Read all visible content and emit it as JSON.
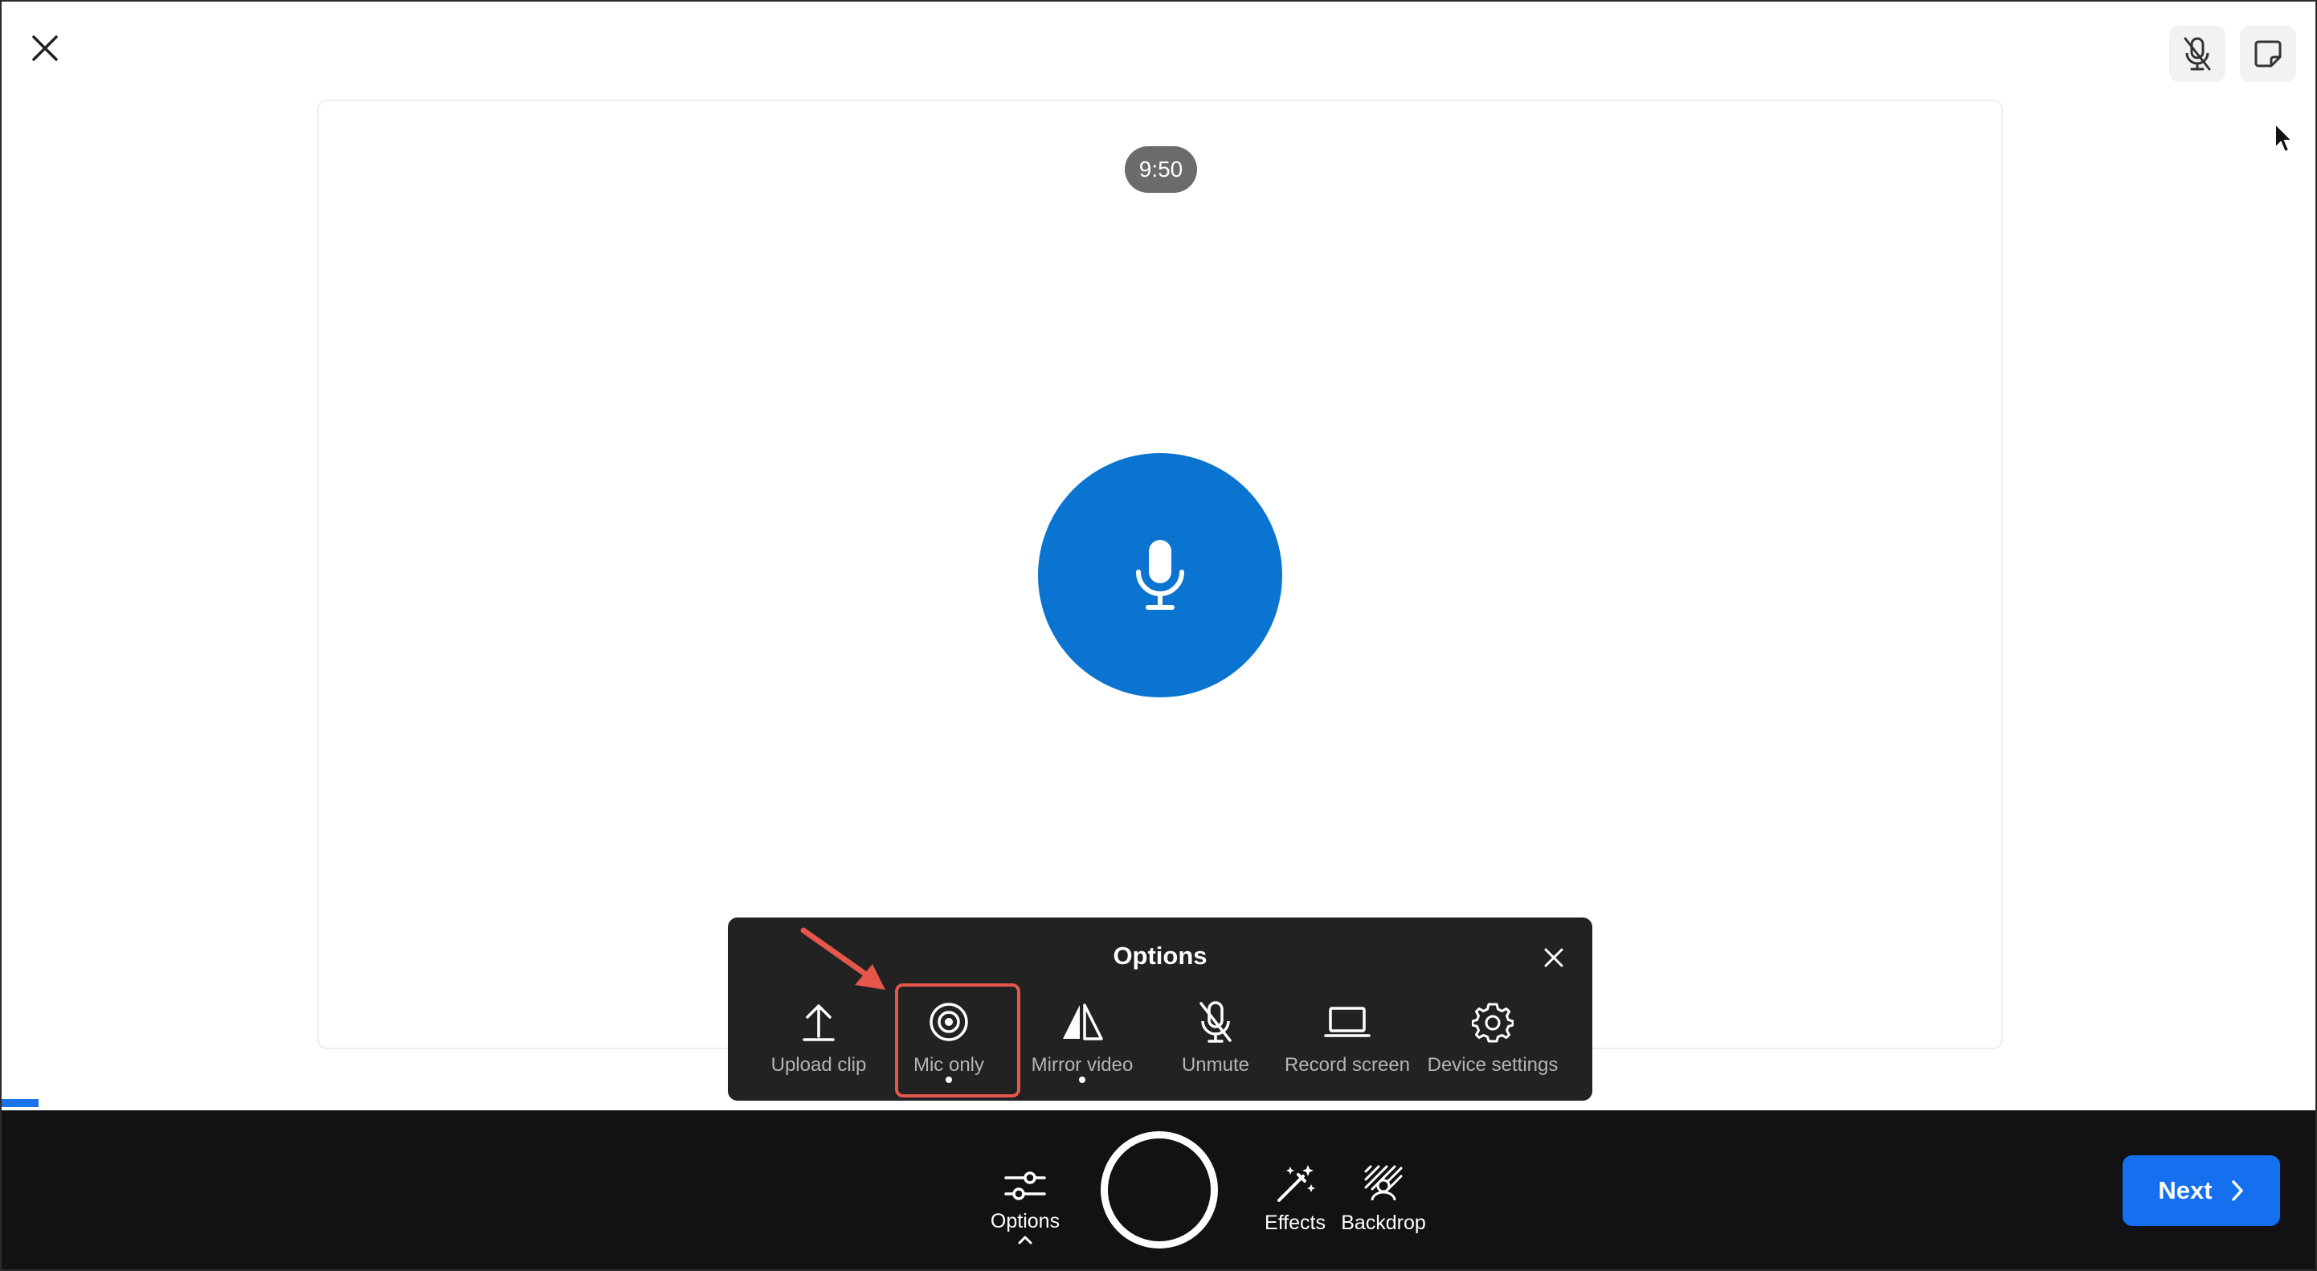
{
  "colors": {
    "accent_blue": "#1570ef",
    "mic_circle_blue": "#0a74d0",
    "panel_bg": "#222222",
    "bottom_bar_bg": "#121214",
    "highlight_red": "#e5574b"
  },
  "header": {
    "close_icon": "close-icon",
    "right_buttons": [
      "mic-off-icon",
      "sticky-note-icon"
    ]
  },
  "preview": {
    "timer": "9:50",
    "center_icon": "microphone-icon"
  },
  "options_panel": {
    "title": "Options",
    "items": [
      {
        "label": "Upload clip",
        "icon": "upload-icon"
      },
      {
        "label": "Mic only",
        "icon": "target-icon",
        "active_dot": true,
        "highlighted": true
      },
      {
        "label": "Mirror video",
        "icon": "mirror-icon",
        "active_dot": true
      },
      {
        "label": "Unmute",
        "icon": "mic-off-icon"
      },
      {
        "label": "Record screen",
        "icon": "laptop-icon"
      },
      {
        "label": "Device settings",
        "icon": "gear-icon"
      }
    ]
  },
  "bottom_bar": {
    "options_label": "Options",
    "effects_label": "Effects",
    "backdrop_label": "Backdrop",
    "next_label": "Next"
  }
}
